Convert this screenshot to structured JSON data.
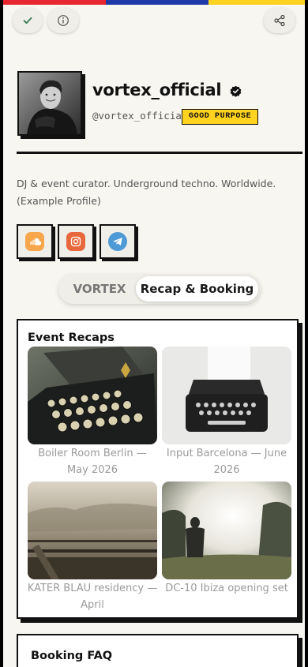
{
  "accent_colors": {
    "red": "#e8262f",
    "blue": "#1f3aa8",
    "yellow": "#ffd21f"
  },
  "header": {
    "check_icon": "check-icon",
    "info_icon": "info-icon",
    "share_icon": "share-icon"
  },
  "profile": {
    "name": "vortex_official",
    "handle": "@vortex_official",
    "badge": "GOOD PURPOSE",
    "bio": "DJ & event curator. Underground techno. Worldwide. (Example Profile)"
  },
  "socials": [
    {
      "name": "soundcloud-icon",
      "color": "#f7a64c"
    },
    {
      "name": "instagram-icon",
      "color": "#e8683d"
    },
    {
      "name": "telegram-icon",
      "color": "#4e9ad6"
    }
  ],
  "tabs": [
    {
      "label": "VORTEX"
    },
    {
      "label": "Recap & Booking"
    }
  ],
  "recaps": {
    "title": "Event Recaps",
    "items": [
      {
        "caption": "Boiler Room Berlin — May 2026"
      },
      {
        "caption": "Input Barcelona — June 2026"
      },
      {
        "caption": "KATER BLAU residency — April"
      },
      {
        "caption": "DC-10 Ibiza opening set"
      }
    ]
  },
  "faq": {
    "title": "Booking FAQ"
  }
}
